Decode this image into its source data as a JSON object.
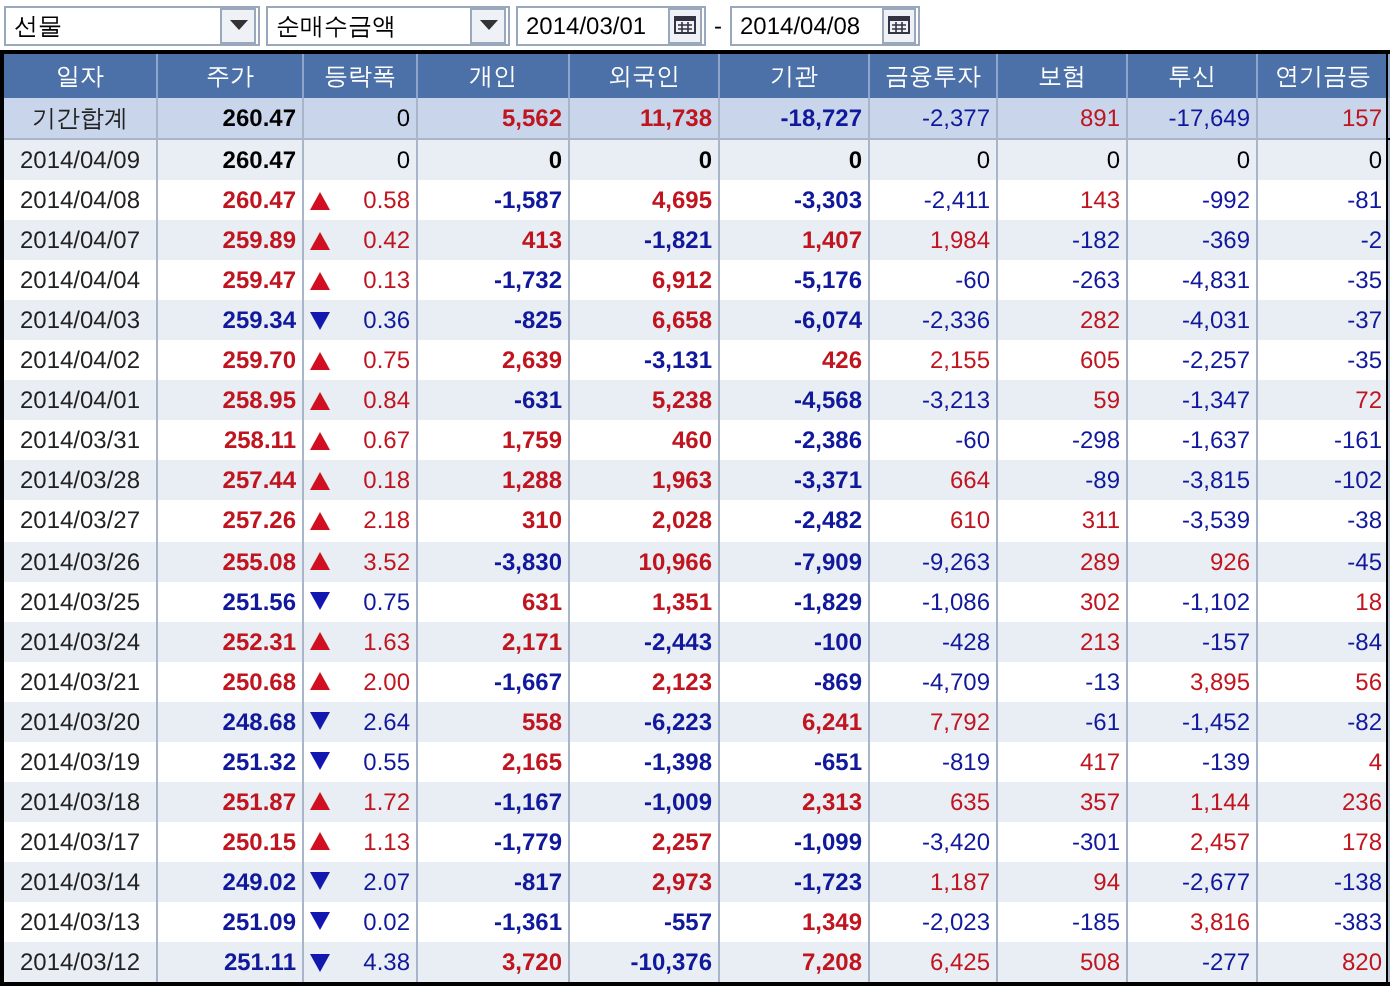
{
  "toolbar": {
    "market_select": {
      "value": "선물"
    },
    "type_select": {
      "value": "순매수금액"
    },
    "start_date": "2014/03/01",
    "separator": "-",
    "end_date": "2014/04/08"
  },
  "table": {
    "columns": [
      "일자",
      "주가",
      "등락폭",
      "개인",
      "외국인",
      "기관",
      "금융투자",
      "보험",
      "투신",
      "연기금등"
    ],
    "total": {
      "label": "기간합계",
      "price": "260.47",
      "change": "0",
      "values": [
        "5,562",
        "11,738",
        "-18,727",
        "-2,377",
        "891",
        "-17,649",
        "157"
      ]
    },
    "rows": [
      {
        "date": "2014/04/09",
        "price": "260.47",
        "kind": "flat",
        "change": "0",
        "values": [
          "0",
          "0",
          "0",
          "0",
          "0",
          "0",
          "0"
        ]
      },
      {
        "date": "2014/04/08",
        "price": "260.47",
        "kind": "up",
        "change": "0.58",
        "values": [
          "-1,587",
          "4,695",
          "-3,303",
          "-2,411",
          "143",
          "-992",
          "-81"
        ]
      },
      {
        "date": "2014/04/07",
        "price": "259.89",
        "kind": "up",
        "change": "0.42",
        "values": [
          "413",
          "-1,821",
          "1,407",
          "1,984",
          "-182",
          "-369",
          "-2"
        ]
      },
      {
        "date": "2014/04/04",
        "price": "259.47",
        "kind": "up",
        "change": "0.13",
        "values": [
          "-1,732",
          "6,912",
          "-5,176",
          "-60",
          "-263",
          "-4,831",
          "-35"
        ]
      },
      {
        "date": "2014/04/03",
        "price": "259.34",
        "kind": "down",
        "change": "0.36",
        "values": [
          "-825",
          "6,658",
          "-6,074",
          "-2,336",
          "282",
          "-4,031",
          "-37"
        ]
      },
      {
        "date": "2014/04/02",
        "price": "259.70",
        "kind": "up",
        "change": "0.75",
        "values": [
          "2,639",
          "-3,131",
          "426",
          "2,155",
          "605",
          "-2,257",
          "-35"
        ]
      },
      {
        "date": "2014/04/01",
        "price": "258.95",
        "kind": "up",
        "change": "0.84",
        "values": [
          "-631",
          "5,238",
          "-4,568",
          "-3,213",
          "59",
          "-1,347",
          "72"
        ]
      },
      {
        "date": "2014/03/31",
        "price": "258.11",
        "kind": "up",
        "change": "0.67",
        "values": [
          "1,759",
          "460",
          "-2,386",
          "-60",
          "-298",
          "-1,637",
          "-161"
        ]
      },
      {
        "date": "2014/03/28",
        "price": "257.44",
        "kind": "up",
        "change": "0.18",
        "values": [
          "1,288",
          "1,963",
          "-3,371",
          "664",
          "-89",
          "-3,815",
          "-102"
        ]
      },
      {
        "date": "2014/03/27",
        "price": "257.26",
        "kind": "up",
        "change": "2.18",
        "values": [
          "310",
          "2,028",
          "-2,482",
          "610",
          "311",
          "-3,539",
          "-38"
        ]
      },
      {
        "date": "2014/03/26",
        "price": "255.08",
        "kind": "up",
        "change": "3.52",
        "values": [
          "-3,830",
          "10,966",
          "-7,909",
          "-9,263",
          "289",
          "926",
          "-45"
        ]
      },
      {
        "date": "2014/03/25",
        "price": "251.56",
        "kind": "down",
        "change": "0.75",
        "values": [
          "631",
          "1,351",
          "-1,829",
          "-1,086",
          "302",
          "-1,102",
          "18"
        ]
      },
      {
        "date": "2014/03/24",
        "price": "252.31",
        "kind": "up",
        "change": "1.63",
        "values": [
          "2,171",
          "-2,443",
          "-100",
          "-428",
          "213",
          "-157",
          "-84"
        ]
      },
      {
        "date": "2014/03/21",
        "price": "250.68",
        "kind": "up",
        "change": "2.00",
        "values": [
          "-1,667",
          "2,123",
          "-869",
          "-4,709",
          "-13",
          "3,895",
          "56"
        ]
      },
      {
        "date": "2014/03/20",
        "price": "248.68",
        "kind": "down",
        "change": "2.64",
        "values": [
          "558",
          "-6,223",
          "6,241",
          "7,792",
          "-61",
          "-1,452",
          "-82"
        ]
      },
      {
        "date": "2014/03/19",
        "price": "251.32",
        "kind": "down",
        "change": "0.55",
        "values": [
          "2,165",
          "-1,398",
          "-651",
          "-819",
          "417",
          "-139",
          "4"
        ]
      },
      {
        "date": "2014/03/18",
        "price": "251.87",
        "kind": "up",
        "change": "1.72",
        "values": [
          "-1,167",
          "-1,009",
          "2,313",
          "635",
          "357",
          "1,144",
          "236"
        ]
      },
      {
        "date": "2014/03/17",
        "price": "250.15",
        "kind": "up",
        "change": "1.13",
        "values": [
          "-1,779",
          "2,257",
          "-1,099",
          "-3,420",
          "-301",
          "2,457",
          "178"
        ]
      },
      {
        "date": "2014/03/14",
        "price": "249.02",
        "kind": "down",
        "change": "2.07",
        "values": [
          "-817",
          "2,973",
          "-1,723",
          "1,187",
          "94",
          "-2,677",
          "-138"
        ]
      },
      {
        "date": "2014/03/13",
        "price": "251.09",
        "kind": "down",
        "change": "0.02",
        "values": [
          "-1,361",
          "-557",
          "1,349",
          "-2,023",
          "-185",
          "3,816",
          "-383"
        ]
      },
      {
        "date": "2014/03/12",
        "price": "251.11",
        "kind": "down",
        "change": "4.38",
        "values": [
          "3,720",
          "-10,376",
          "7,208",
          "6,425",
          "508",
          "-277",
          "820"
        ]
      }
    ]
  }
}
